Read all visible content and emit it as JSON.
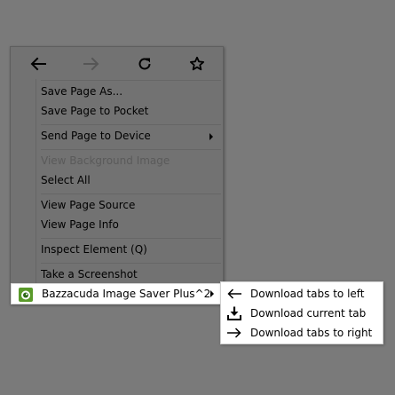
{
  "nav": [
    {
      "name": "back",
      "icon": "back-arrow-icon",
      "enabled": true
    },
    {
      "name": "forward",
      "icon": "forward-arrow-icon",
      "enabled": false
    },
    {
      "name": "reload",
      "icon": "reload-icon",
      "enabled": true
    },
    {
      "name": "bookmark",
      "icon": "star-icon",
      "enabled": true
    }
  ],
  "menu": {
    "save_page_as": "Save Page As...",
    "save_to_pocket": "Save Page to Pocket",
    "send_to_device": "Send Page to Device",
    "view_background_image": "View Background Image",
    "select_all": "Select All",
    "view_page_source": "View Page Source",
    "view_page_info": "View Page Info",
    "inspect_element": "Inspect Element (Q)",
    "take_screenshot": "Take a Screenshot",
    "extension_item": "Bazzacuda Image Saver Plus^2"
  },
  "submenu": {
    "items": [
      {
        "label": "Download tabs to left",
        "icon": "left-arrow-icon"
      },
      {
        "label": "Download current tab",
        "icon": "download-icon"
      },
      {
        "label": "Download tabs to right",
        "icon": "right-arrow-icon"
      }
    ]
  },
  "colors": {
    "overlay": "#7a7a7a",
    "menu_bg": "#727272",
    "highlight_bg": "#ffffff",
    "extension_icon_green": "#5a9a2a"
  }
}
